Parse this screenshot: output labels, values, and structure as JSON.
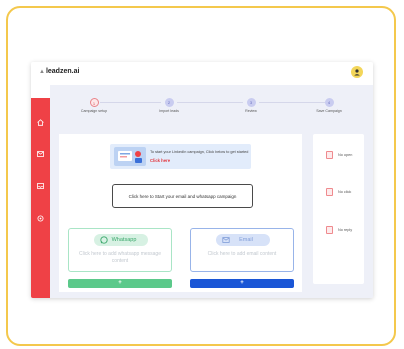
{
  "app": {
    "logo_text": "leadzen.ai"
  },
  "sidebar": {
    "icons": [
      "home-icon",
      "mail-icon",
      "inbox-icon",
      "settings-icon"
    ]
  },
  "steps": [
    {
      "number": "1",
      "label": "Campaign setup",
      "active": true
    },
    {
      "number": "2",
      "label": "Import leads",
      "active": false
    },
    {
      "number": "3",
      "label": "Review",
      "active": false
    },
    {
      "number": "4",
      "label": "Save Campaign",
      "active": false
    }
  ],
  "banner": {
    "text": "To start your LinkedIn campaign, Click below to get started",
    "link": "Click here"
  },
  "cta": {
    "label": "Click here to Start your email and whatsapp campaign"
  },
  "channels": {
    "whatsapp": {
      "title": "Whatsapp",
      "desc": "Click here to add whatsapp message content",
      "add_label": "+"
    },
    "email": {
      "title": "Email",
      "desc": "Click here to add email content",
      "add_label": "+"
    }
  },
  "stats": [
    {
      "label": "No open"
    },
    {
      "label": "No click"
    },
    {
      "label": "No reply"
    }
  ],
  "colors": {
    "accent": "#ef4146",
    "whatsapp": "#5bc98a",
    "email": "#1a56d6",
    "frame": "#f4c84c"
  }
}
